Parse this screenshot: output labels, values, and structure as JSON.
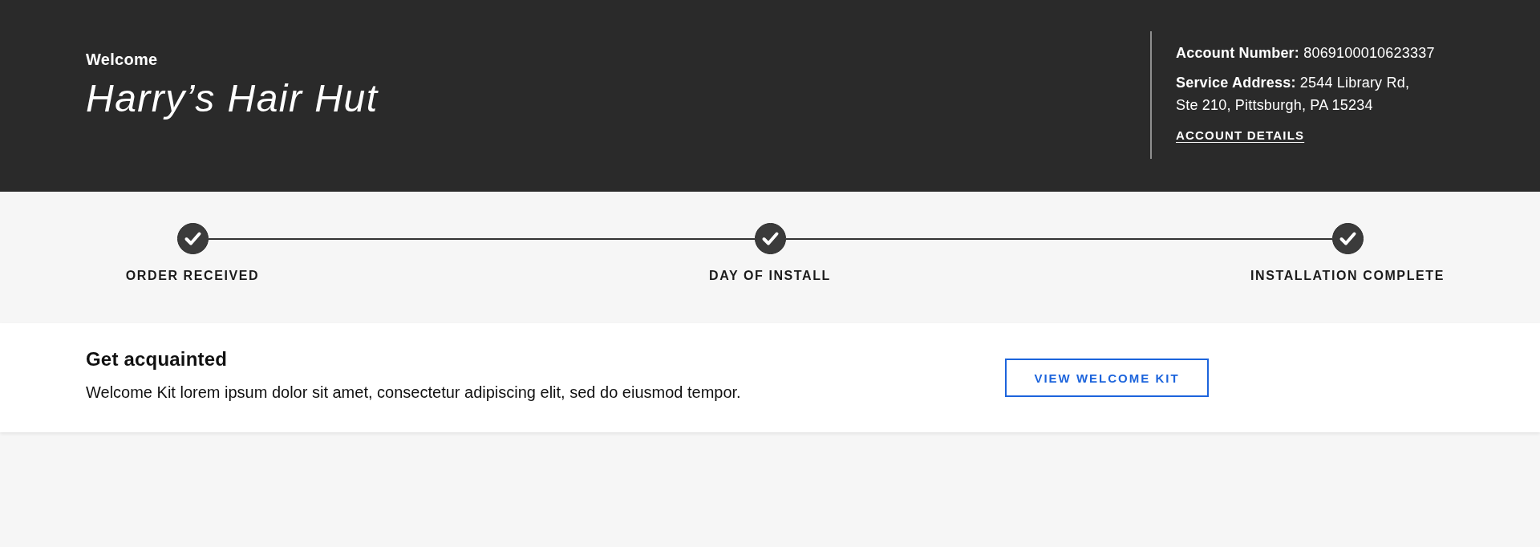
{
  "header": {
    "greeting": "Welcome",
    "business_name": "Harry’s Hair Hut",
    "account": {
      "number_label": "Account Number:",
      "number": "8069100010623337",
      "address_label": "Service Address:",
      "address_lines": [
        "2544 Library Rd,",
        "Ste 210, Pittsburgh, PA 15234"
      ],
      "details_link": "ACCOUNT DETAILS"
    }
  },
  "progress": {
    "steps": [
      {
        "label": "ORDER RECEIVED",
        "completed": true
      },
      {
        "label": "DAY OF INSTALL",
        "completed": true
      },
      {
        "label": "INSTALLATION COMPLETE",
        "completed": true
      }
    ]
  },
  "welcome_card": {
    "title": "Get acquainted",
    "description": "Welcome Kit lorem ipsum dolor sit amet, consectetur adipiscing elit, sed do eiusmod tempor.",
    "button": "VIEW WELCOME KIT"
  }
}
